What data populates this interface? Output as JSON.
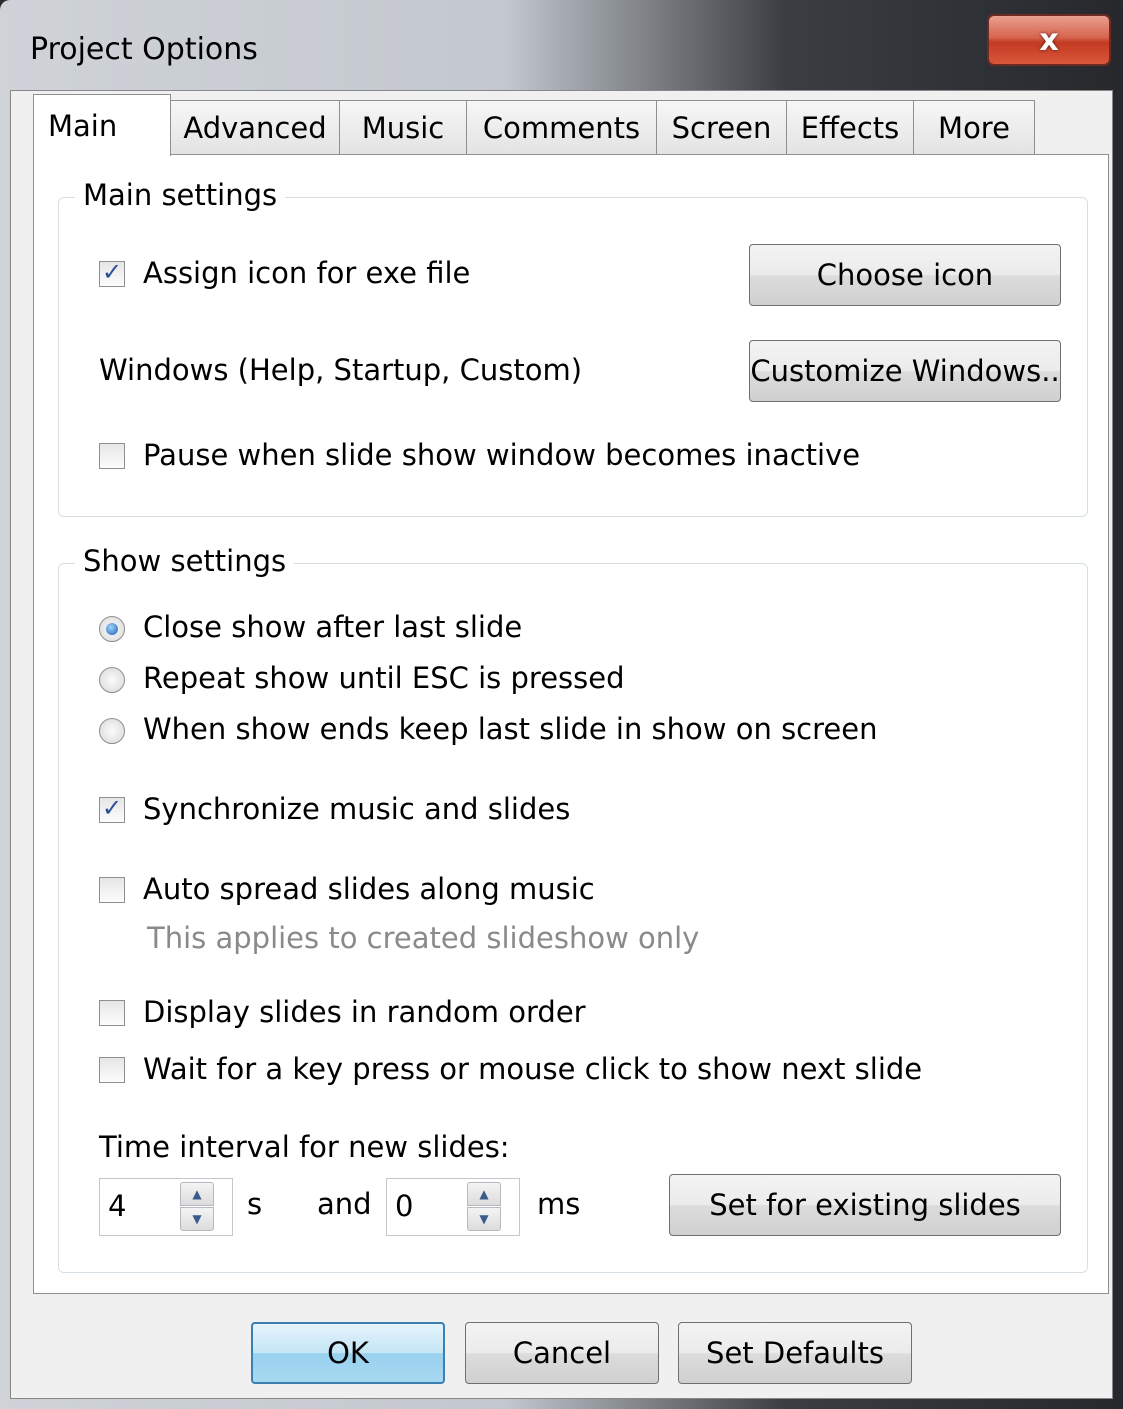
{
  "window": {
    "title": "Project Options",
    "close_glyph": "x"
  },
  "tabs": [
    {
      "label": "Main"
    },
    {
      "label": "Advanced"
    },
    {
      "label": "Music"
    },
    {
      "label": "Comments"
    },
    {
      "label": "Screen"
    },
    {
      "label": "Effects"
    },
    {
      "label": "More"
    }
  ],
  "main_settings": {
    "title": "Main settings",
    "assign_icon": {
      "label": "Assign icon for exe file",
      "checked": true
    },
    "choose_icon_label": "Choose icon",
    "windows_label": "Windows (Help, Startup, Custom)",
    "customize_windows_label": "Customize Windows..",
    "pause_inactive": {
      "label": "Pause when slide show window becomes inactive",
      "checked": false
    }
  },
  "show_settings": {
    "title": "Show settings",
    "radios": [
      {
        "label": "Close show after last slide",
        "selected": true
      },
      {
        "label": "Repeat show until ESC is pressed",
        "selected": false
      },
      {
        "label": "When show ends keep last slide in show on screen",
        "selected": false
      }
    ],
    "sync_music": {
      "label": "Synchronize music and slides",
      "checked": true
    },
    "auto_spread": {
      "label": "Auto spread slides along music",
      "checked": false
    },
    "auto_spread_hint": "This applies to created slideshow only",
    "random_order": {
      "label": "Display slides in random order",
      "checked": false
    },
    "wait_key": {
      "label": "Wait for a key press or mouse click to show next slide",
      "checked": false
    },
    "interval_label": "Time interval for new slides:",
    "seconds_value": "4",
    "seconds_unit": "s",
    "and_label": "and",
    "ms_value": "0",
    "ms_unit": "ms",
    "set_existing_label": "Set for existing slides"
  },
  "footer": {
    "ok_label": "OK",
    "cancel_label": "Cancel",
    "defaults_label": "Set Defaults"
  },
  "check_glyph": "✓"
}
